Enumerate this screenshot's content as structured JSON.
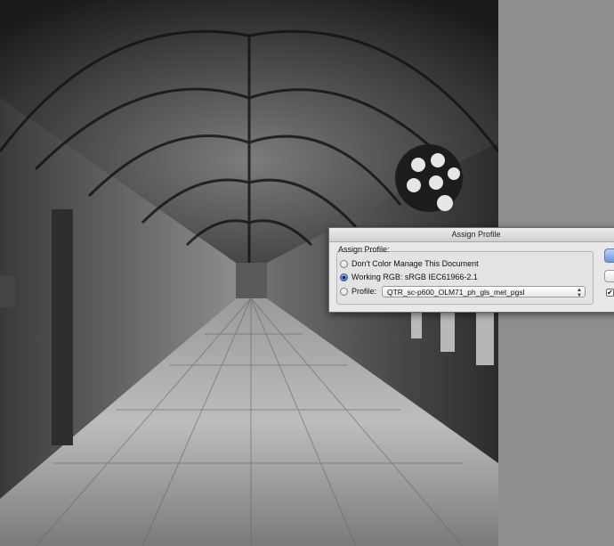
{
  "dialog": {
    "title": "Assign Profile",
    "group_label": "Assign Profile:",
    "options": {
      "dont_manage": "Don't Color Manage This Document",
      "working_rgb": "Working RGB:  sRGB IEC61966-2.1",
      "profile": "Profile:"
    },
    "selected_option": "working_rgb",
    "profile_value": "QTR_sc-p600_OLM71_ph_gls_met_pgsl",
    "preview_checked": true,
    "check_glyph": "✔"
  },
  "colors": {
    "dialog_bg": "#e8e8e8",
    "accent": "#3f73c4",
    "gutter": "#8e8e8e"
  }
}
